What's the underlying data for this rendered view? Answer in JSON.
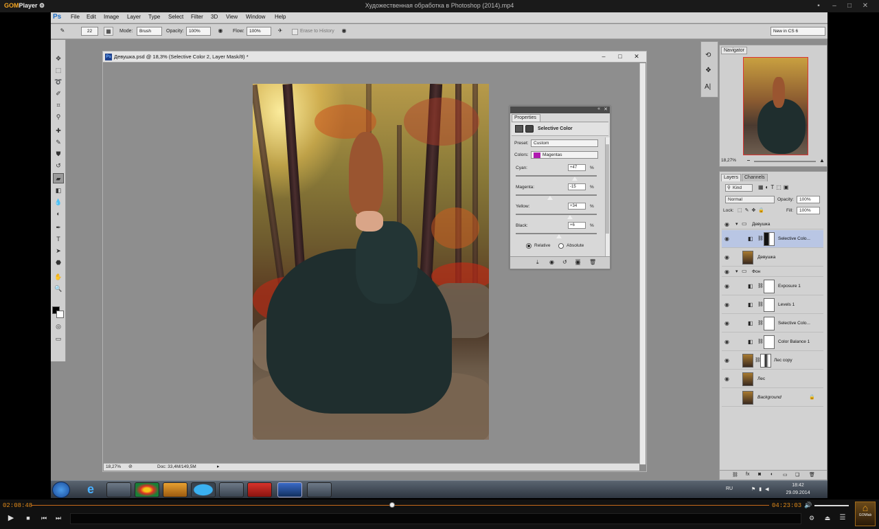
{
  "player": {
    "logo_name": "GOM",
    "logo_suffix": "Player",
    "title": "Художественная обработка в Photoshop (2014).mp4",
    "time_current": "02:08:48",
    "time_total": "04:23:03",
    "brand_label": "GOMlab"
  },
  "menu": [
    "File",
    "Edit",
    "Image",
    "Layer",
    "Type",
    "Select",
    "Filter",
    "3D",
    "View",
    "Window",
    "Help"
  ],
  "options": {
    "brush_size": "22",
    "mode_label": "Mode:",
    "mode_value": "Brush",
    "opacity_label": "Opacity:",
    "opacity_value": "100%",
    "flow_label": "Flow:",
    "flow_value": "100%",
    "erase_history": "Erase to History",
    "workspace": "New in CS 6"
  },
  "document": {
    "title": "Девушка.psd @ 18,3% (Selective Color 2, Layer Mask/8) *",
    "zoom": "18,27%",
    "doc_info": "Doc: 33,4M/149,5M"
  },
  "properties": {
    "tab": "Properties",
    "heading": "Selective Color",
    "preset_label": "Preset:",
    "preset_value": "Custom",
    "colors_label": "Colors:",
    "colors_value": "Magentas",
    "sliders": [
      {
        "label": "Cyan:",
        "value": "+47",
        "pct": 0.73
      },
      {
        "label": "Magenta:",
        "value": "-15",
        "pct": 0.42
      },
      {
        "label": "Yellow:",
        "value": "+34",
        "pct": 0.67
      },
      {
        "label": "Black:",
        "value": "+6",
        "pct": 0.53
      }
    ],
    "unit": "%",
    "relative": "Relative",
    "absolute": "Absolute",
    "mode_selected": "Relative"
  },
  "navigator": {
    "tab": "Navigator",
    "zoom": "18,27%"
  },
  "layers": {
    "tab_layers": "Layers",
    "tab_channels": "Channels",
    "kind": "Kind",
    "blend": "Normal",
    "opacity_label": "Opacity:",
    "opacity_value": "100%",
    "lock_label": "Lock:",
    "fill_label": "Fill:",
    "fill_value": "100%",
    "rows": [
      {
        "name": "Девушка",
        "type": "group"
      },
      {
        "name": "Selective Colo...",
        "type": "adjust",
        "selected": true
      },
      {
        "name": "Девушка",
        "type": "image"
      },
      {
        "name": "Фон",
        "type": "group"
      },
      {
        "name": "Exposure 1",
        "type": "adjust"
      },
      {
        "name": "Levels 1",
        "type": "adjust"
      },
      {
        "name": "Selective Colo...",
        "type": "adjust"
      },
      {
        "name": "Color Balance 1",
        "type": "adjust"
      },
      {
        "name": "Лес copy",
        "type": "image"
      },
      {
        "name": "Лес",
        "type": "image"
      },
      {
        "name": "Background",
        "type": "background"
      }
    ]
  },
  "taskbar": {
    "lang": "RU",
    "time": "18:42",
    "date": "29.09.2014"
  },
  "colors": {
    "accent": "#e08a1a",
    "selected_layer": "#b9c6e4",
    "magenta_swatch": "#b01ab0"
  }
}
